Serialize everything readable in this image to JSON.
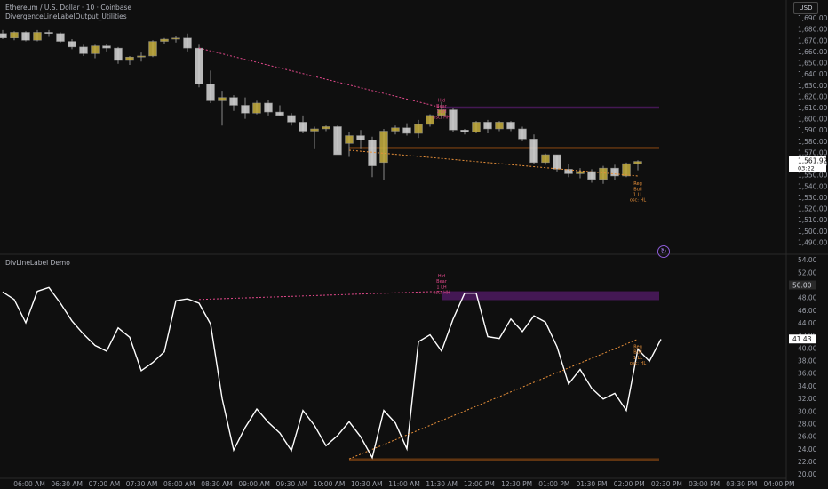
{
  "header": {
    "symbol_line": "Ethereum / U.S. Dollar · 10 · Coinbase",
    "indicator_line": "DivergenceLineLabelOutput_Utilities",
    "currency_button": "USD"
  },
  "oscillator": {
    "title": "DivLineLabel Demo"
  },
  "colors": {
    "background": "#0f0f0f",
    "candle_up_fill": "#c8b040",
    "candle_down_fill": "#d8d8d8",
    "bear_divergence": "#e0488a",
    "bull_divergence": "#e8903a",
    "supply_zone": "#4a1a5c",
    "demand_zone": "#6a3a12",
    "oscillator_line": "#ffffff"
  },
  "chart_data": [
    {
      "type": "candlestick",
      "price_axis": {
        "ticks": [
          "1,690.00",
          "1,680.00",
          "1,670.00",
          "1,660.00",
          "1,650.00",
          "1,640.00",
          "1,630.00",
          "1,620.00",
          "1,610.00",
          "1,600.00",
          "1,590.00",
          "1,580.00",
          "1,570.00",
          "1,560.00",
          "1,550.00",
          "1,540.00",
          "1,530.00",
          "1,520.00",
          "1,510.00",
          "1,500.00",
          "1,490.00"
        ],
        "ylim": [
          1484,
          1694
        ]
      },
      "last_price_label": "1,561.92",
      "countdown_label": "03:22",
      "candles": [
        {
          "o": 1676,
          "h": 1679,
          "l": 1671,
          "c": 1672
        },
        {
          "o": 1672,
          "h": 1678,
          "l": 1670,
          "c": 1677
        },
        {
          "o": 1677,
          "h": 1678,
          "l": 1669,
          "c": 1670
        },
        {
          "o": 1670,
          "h": 1679,
          "l": 1669,
          "c": 1677
        },
        {
          "o": 1677,
          "h": 1679,
          "l": 1673,
          "c": 1676
        },
        {
          "o": 1676,
          "h": 1677,
          "l": 1668,
          "c": 1669
        },
        {
          "o": 1669,
          "h": 1671,
          "l": 1662,
          "c": 1664
        },
        {
          "o": 1664,
          "h": 1666,
          "l": 1656,
          "c": 1658
        },
        {
          "o": 1658,
          "h": 1666,
          "l": 1654,
          "c": 1665
        },
        {
          "o": 1665,
          "h": 1667,
          "l": 1660,
          "c": 1663
        },
        {
          "o": 1663,
          "h": 1664,
          "l": 1649,
          "c": 1652
        },
        {
          "o": 1652,
          "h": 1656,
          "l": 1648,
          "c": 1655
        },
        {
          "o": 1655,
          "h": 1659,
          "l": 1651,
          "c": 1656
        },
        {
          "o": 1656,
          "h": 1670,
          "l": 1655,
          "c": 1669
        },
        {
          "o": 1669,
          "h": 1672,
          "l": 1667,
          "c": 1671
        },
        {
          "o": 1671,
          "h": 1674,
          "l": 1668,
          "c": 1672
        },
        {
          "o": 1672,
          "h": 1676,
          "l": 1660,
          "c": 1663
        },
        {
          "o": 1663,
          "h": 1666,
          "l": 1628,
          "c": 1631
        },
        {
          "o": 1631,
          "h": 1643,
          "l": 1614,
          "c": 1616
        },
        {
          "o": 1616,
          "h": 1625,
          "l": 1594,
          "c": 1619
        },
        {
          "o": 1619,
          "h": 1621,
          "l": 1607,
          "c": 1612
        },
        {
          "o": 1612,
          "h": 1619,
          "l": 1600,
          "c": 1605
        },
        {
          "o": 1605,
          "h": 1616,
          "l": 1604,
          "c": 1614
        },
        {
          "o": 1614,
          "h": 1617,
          "l": 1603,
          "c": 1606
        },
        {
          "o": 1606,
          "h": 1612,
          "l": 1603,
          "c": 1603
        },
        {
          "o": 1603,
          "h": 1605,
          "l": 1594,
          "c": 1597
        },
        {
          "o": 1597,
          "h": 1603,
          "l": 1587,
          "c": 1589
        },
        {
          "o": 1589,
          "h": 1593,
          "l": 1573,
          "c": 1591
        },
        {
          "o": 1591,
          "h": 1594,
          "l": 1589,
          "c": 1593
        },
        {
          "o": 1593,
          "h": 1594,
          "l": 1571,
          "c": 1568
        },
        {
          "o": 1578,
          "h": 1588,
          "l": 1566,
          "c": 1585
        },
        {
          "o": 1585,
          "h": 1590,
          "l": 1573,
          "c": 1581
        },
        {
          "o": 1581,
          "h": 1584,
          "l": 1548,
          "c": 1558
        },
        {
          "o": 1561,
          "h": 1591,
          "l": 1545,
          "c": 1589
        },
        {
          "o": 1589,
          "h": 1594,
          "l": 1586,
          "c": 1592
        },
        {
          "o": 1592,
          "h": 1596,
          "l": 1585,
          "c": 1587
        },
        {
          "o": 1587,
          "h": 1599,
          "l": 1583,
          "c": 1595
        },
        {
          "o": 1595,
          "h": 1604,
          "l": 1593,
          "c": 1603
        },
        {
          "o": 1603,
          "h": 1615,
          "l": 1600,
          "c": 1608
        },
        {
          "o": 1608,
          "h": 1610,
          "l": 1588,
          "c": 1590
        },
        {
          "o": 1590,
          "h": 1591,
          "l": 1586,
          "c": 1588
        },
        {
          "o": 1588,
          "h": 1598,
          "l": 1587,
          "c": 1597
        },
        {
          "o": 1597,
          "h": 1599,
          "l": 1587,
          "c": 1591
        },
        {
          "o": 1591,
          "h": 1598,
          "l": 1589,
          "c": 1597
        },
        {
          "o": 1597,
          "h": 1598,
          "l": 1589,
          "c": 1591
        },
        {
          "o": 1591,
          "h": 1593,
          "l": 1580,
          "c": 1582
        },
        {
          "o": 1582,
          "h": 1586,
          "l": 1560,
          "c": 1561
        },
        {
          "o": 1561,
          "h": 1569,
          "l": 1559,
          "c": 1568
        },
        {
          "o": 1568,
          "h": 1568,
          "l": 1553,
          "c": 1555
        },
        {
          "o": 1555,
          "h": 1560,
          "l": 1548,
          "c": 1551
        },
        {
          "o": 1551,
          "h": 1556,
          "l": 1547,
          "c": 1553
        },
        {
          "o": 1553,
          "h": 1555,
          "l": 1543,
          "c": 1546
        },
        {
          "o": 1546,
          "h": 1558,
          "l": 1542,
          "c": 1556
        },
        {
          "o": 1556,
          "h": 1559,
          "l": 1545,
          "c": 1549
        },
        {
          "o": 1549,
          "h": 1561,
          "l": 1548,
          "c": 1560
        },
        {
          "o": 1560,
          "h": 1563,
          "l": 1554,
          "c": 1562
        }
      ],
      "divergence_lines": [
        {
          "kind": "bear",
          "from": {
            "bar": 17,
            "price": 1663
          },
          "to": {
            "bar": 38,
            "price": 1610
          }
        },
        {
          "kind": "bull",
          "from": {
            "bar": 30,
            "price": 1572
          },
          "to": {
            "bar": 55,
            "price": 1549
          }
        }
      ],
      "zones": [
        {
          "kind": "supply",
          "from_bar": 38,
          "to_bar": 57,
          "top": 1611,
          "bottom": 1609
        },
        {
          "kind": "demand",
          "from_bar": 30,
          "to_bar": 57,
          "top": 1575,
          "bottom": 1573
        }
      ],
      "annotations": [
        {
          "kind": "bear",
          "bar": 38,
          "price": 1615,
          "lines": [
            "Hid",
            "Bear",
            "1 LH",
            "osc: HH"
          ]
        },
        {
          "kind": "bull",
          "bar": 55,
          "price": 1541,
          "lines": [
            "Reg",
            "Bull",
            "1 LL",
            "osc: HL"
          ]
        }
      ]
    },
    {
      "type": "line",
      "title": "DivLineLabel Demo",
      "value_axis": {
        "ticks": [
          "54.00",
          "52.00",
          "50.00",
          "48.00",
          "46.00",
          "44.00",
          "42.00",
          "40.00",
          "38.00",
          "36.00",
          "34.00",
          "32.00",
          "30.00",
          "28.00",
          "26.00",
          "24.00",
          "22.00",
          "20.00"
        ],
        "ylim": [
          19.6,
          54.3
        ]
      },
      "reference_level_label": "50.00",
      "last_value_label": "41.43",
      "values": [
        48.9,
        47.7,
        44.0,
        49.0,
        49.6,
        47.1,
        44.3,
        42.2,
        40.4,
        39.5,
        43.2,
        41.7,
        36.4,
        37.7,
        39.4,
        47.5,
        47.8,
        47.1,
        43.8,
        32.0,
        23.8,
        27.4,
        30.3,
        28.2,
        26.5,
        23.7,
        30.1,
        27.7,
        24.5,
        26.1,
        28.3,
        25.9,
        22.6,
        30.1,
        28.1,
        24.0,
        41.0,
        42.1,
        39.5,
        44.6,
        48.7,
        48.7,
        41.8,
        41.5,
        44.6,
        42.6,
        45.1,
        44.1,
        40.2,
        34.3,
        36.6,
        33.6,
        31.9,
        32.8,
        30.1,
        39.8,
        37.9,
        41.4
      ],
      "divergence_lines": [
        {
          "kind": "bear",
          "from": {
            "bar": 17,
            "value": 47.7
          },
          "to": {
            "bar": 38,
            "value": 49.0
          }
        },
        {
          "kind": "bull",
          "from": {
            "bar": 30,
            "value": 22.4
          },
          "to": {
            "bar": 55,
            "value": 41.4
          }
        }
      ],
      "zones": [
        {
          "kind": "supply",
          "from_bar": 38,
          "to_bar": 57,
          "top": 49.0,
          "bottom": 47.6
        },
        {
          "kind": "demand",
          "from_bar": 30,
          "to_bar": 57,
          "top": 22.5,
          "bottom": 22.1
        }
      ],
      "annotations": [
        {
          "kind": "bear",
          "bar": 38,
          "value": 51.2,
          "lines": [
            "Hid",
            "Bear",
            "1 LH",
            "osc: HH"
          ]
        },
        {
          "kind": "bull",
          "bar": 55,
          "value": 40.0,
          "lines": [
            "Reg",
            "Bull",
            "1 LL",
            "osc: HL"
          ]
        }
      ]
    }
  ],
  "time_axis": {
    "labels": [
      "06:00 AM",
      "06:30 AM",
      "07:00 AM",
      "07:30 AM",
      "08:00 AM",
      "08:30 AM",
      "09:00 AM",
      "09:30 AM",
      "10:00 AM",
      "10:30 AM",
      "11:00 AM",
      "11:30 AM",
      "12:00 PM",
      "12:30 PM",
      "01:00 PM",
      "01:30 PM",
      "02:00 PM",
      "02:30 PM",
      "03:00 PM",
      "03:30 PM",
      "04:00 PM"
    ]
  }
}
